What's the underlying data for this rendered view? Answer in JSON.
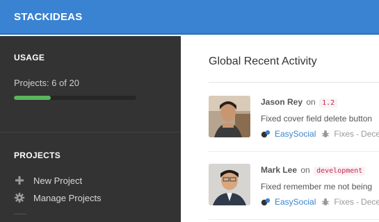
{
  "app": {
    "brand": "STACKIDEAS"
  },
  "sidebar": {
    "usage_heading": "USAGE",
    "usage_text": "Projects: 6 of 20",
    "usage_used": 6,
    "usage_total": 20,
    "projects_heading": "PROJECTS",
    "links": [
      {
        "label": "New Project",
        "icon": "plus-icon"
      },
      {
        "label": "Manage Projects",
        "icon": "gear-icon"
      }
    ]
  },
  "main": {
    "title": "Global Recent Activity",
    "activities": [
      {
        "user": "Jason Rey",
        "on": "on",
        "tag": "1.2",
        "message": "Fixed cover field delete button",
        "project": "EasySocial",
        "category": "Fixes",
        "date": "Dece"
      },
      {
        "user": "Mark Lee",
        "on": "on",
        "tag": "development",
        "message": "Fixed remember me not being",
        "project": "EasySocial",
        "category": "Fixes",
        "date": "Dece"
      }
    ]
  },
  "colors": {
    "topbar": "#3a82d2",
    "sidebar": "#333333",
    "progress": "#5ab55d",
    "link": "#3a82d2",
    "tag": "#c7254e"
  }
}
